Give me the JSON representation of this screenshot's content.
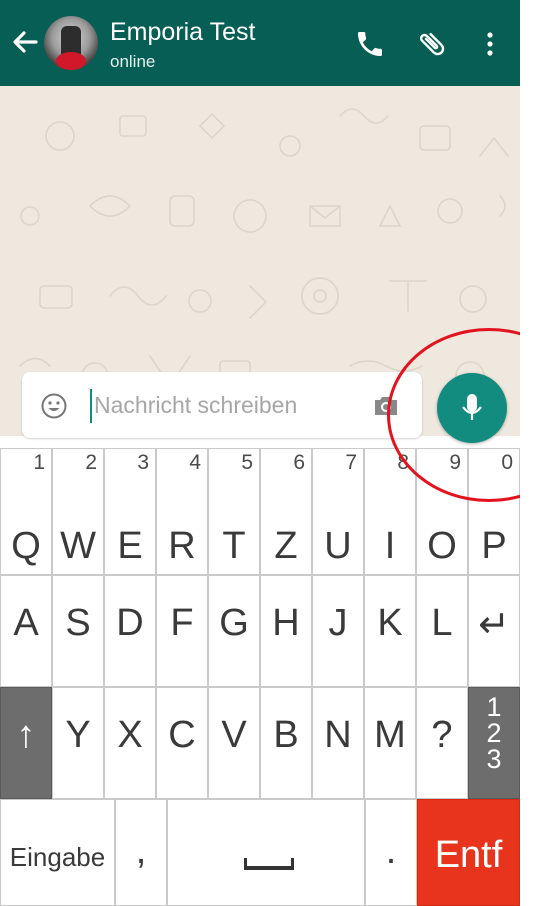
{
  "header": {
    "title": "Emporia Test",
    "status": "online",
    "icons": [
      "back-arrow-icon",
      "avatar",
      "phone-icon",
      "paperclip-icon",
      "more-vert-icon"
    ]
  },
  "composer": {
    "placeholder": "Nachricht schreiben",
    "value": "",
    "icons": [
      "emoji-icon",
      "camera-icon",
      "mic-icon"
    ]
  },
  "keyboard": {
    "row1": [
      {
        "label": "Q",
        "num": "1"
      },
      {
        "label": "W",
        "num": "2"
      },
      {
        "label": "E",
        "num": "3"
      },
      {
        "label": "R",
        "num": "4"
      },
      {
        "label": "T",
        "num": "5"
      },
      {
        "label": "Z",
        "num": "6"
      },
      {
        "label": "U",
        "num": "7"
      },
      {
        "label": "I",
        "num": "8"
      },
      {
        "label": "O",
        "num": "9"
      },
      {
        "label": "P",
        "num": "0"
      }
    ],
    "row2": [
      "A",
      "S",
      "D",
      "F",
      "G",
      "H",
      "J",
      "K",
      "L",
      "↵"
    ],
    "row3": [
      "↑",
      "Y",
      "X",
      "C",
      "V",
      "B",
      "N",
      "M",
      "?"
    ],
    "numbers_toggle": [
      "1",
      "2",
      "3"
    ],
    "bottom": {
      "enter": "Eingabe",
      "comma": ",",
      "dot": ".",
      "delete": "Entf"
    }
  },
  "colors": {
    "header_bg": "#075E54",
    "accent": "#128C7E",
    "delete_key": "#E8341C",
    "annotation_circle": "#E2121E"
  }
}
